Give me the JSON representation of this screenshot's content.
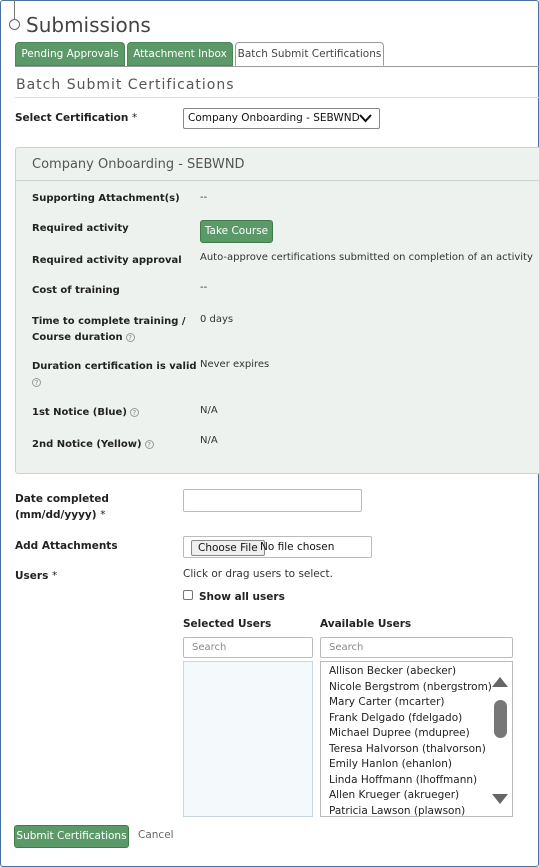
{
  "page": {
    "title": "Submissions"
  },
  "tabs": [
    {
      "label": "Pending Approvals"
    },
    {
      "label": "Attachment Inbox"
    },
    {
      "label": "Batch Submit Certifications"
    }
  ],
  "section_title": "Batch Submit Certifications",
  "certification": {
    "label": "Select Certification",
    "required_mark": "*",
    "value": "Company Onboarding - SEBWND"
  },
  "details": {
    "title": "Company Onboarding - SEBWND",
    "supporting_label": "Supporting Attachment(s)",
    "supporting_value": "--",
    "required_activity_label": "Required activity",
    "take_course": "Take Course",
    "approval_label": "Required activity approval",
    "approval_value": "Auto-approve certifications submitted on completion of an activity",
    "cost_label": "Cost of training",
    "cost_value": "--",
    "time_label_1": "Time to complete training /",
    "time_label_2": "Course duration",
    "time_value": "0 days",
    "duration_label": "Duration certification is valid",
    "duration_value": "Never expires",
    "notice1_label": "1st Notice (Blue)",
    "notice1_value": "N/A",
    "notice2_label": "2nd Notice (Yellow)",
    "notice2_value": "N/A",
    "help_glyph": "?"
  },
  "form": {
    "date_label_1": "Date completed",
    "date_label_2": "(mm/dd/yyyy)",
    "required_mark": "*",
    "date_value": "",
    "attachments_label": "Add Attachments",
    "choose_file": "Choose File",
    "no_file": "No file chosen",
    "users_label": "Users",
    "users_hint": "Click or drag users to select.",
    "show_all": "Show all users"
  },
  "selected_users": {
    "heading": "Selected Users",
    "search_placeholder": "Search",
    "items": []
  },
  "available_users": {
    "heading": "Available Users",
    "search_placeholder": "Search",
    "items": [
      "Allison Becker (abecker)",
      "Nicole Bergstrom (nbergstrom)",
      "Mary Carter (mcarter)",
      "Frank Delgado (fdelgado)",
      "Michael Dupree (mdupree)",
      "Teresa Halvorson (thalvorson)",
      "Emily Hanlon (ehanlon)",
      "Linda Hoffmann (lhoffmann)",
      "Allen Krueger (akrueger)",
      "Patricia Lawson (plawson)"
    ]
  },
  "actions": {
    "submit": "Submit Certifications",
    "cancel": "Cancel"
  },
  "colors": {
    "accent_green": "#5b9a68",
    "panel_bg": "#eef2ef"
  }
}
